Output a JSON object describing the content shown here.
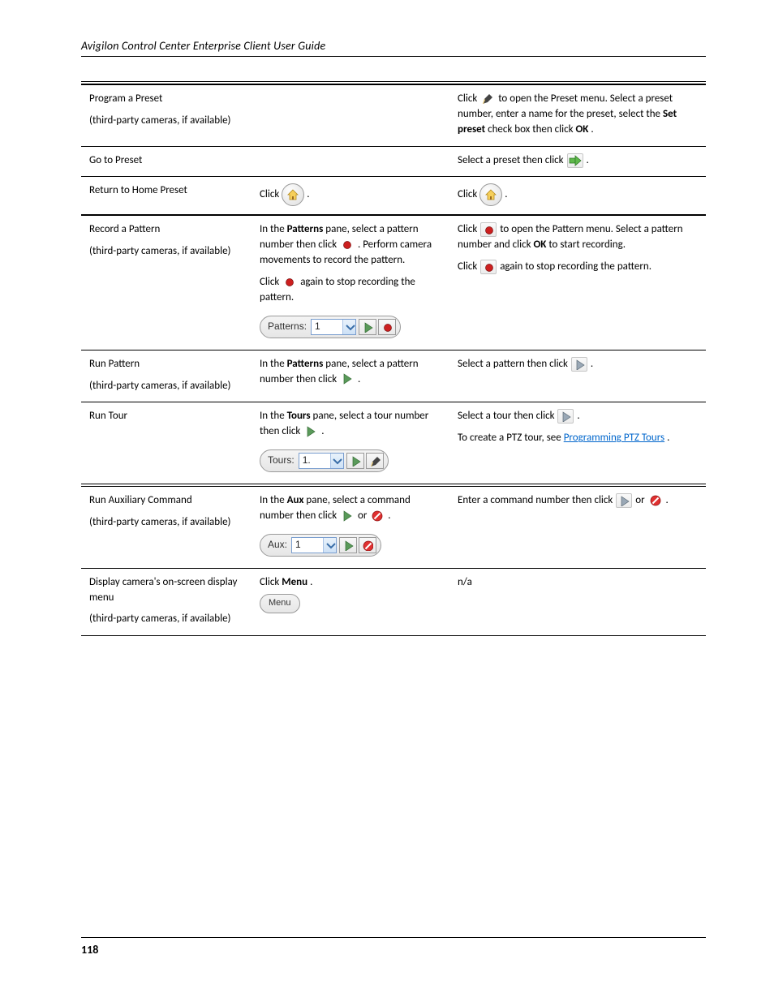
{
  "header": {
    "title": "Avigilon Control Center Enterprise Client User Guide"
  },
  "footer": {
    "page": "118"
  },
  "rows": [
    {
      "c1_a": "Program a Preset",
      "c1_b": "(third-party cameras, if available)",
      "c3_a": "Click ",
      "c3_b": " to open the Preset menu. Select a preset number, enter a name for the preset, select the ",
      "c3_c": "Set preset",
      "c3_d": " check box then click ",
      "c3_e": "OK",
      "c3_f": "."
    },
    {
      "c1_a": "Go to Preset",
      "c3_a": "Select a preset then click ",
      "c3_b": "."
    },
    {
      "c1_a": "Return to Home Preset",
      "c2_a": "Click ",
      "c2_b": ".",
      "c3_a": "Click ",
      "c3_b": "."
    },
    {
      "c1_a": "Record a Pattern",
      "c1_b": "(third-party cameras, if available)",
      "c2_a": "In the ",
      "c2_b": "Patterns",
      "c2_c": " pane, select a pattern number then click ",
      "c2_d": ". Perform camera movements to record the pattern.",
      "c2_e": "Click ",
      "c2_f": " again to stop recording the pattern.",
      "c3_a": "Click ",
      "c3_b": " to open the Pattern menu. Select a pattern number and click ",
      "c3_c": "OK",
      "c3_d": " to start recording.",
      "c3_e": "Click ",
      "c3_f": " again to stop recording the pattern.",
      "patterns_label": "Patterns:",
      "patterns_value": "1"
    },
    {
      "c1_a": "Run Pattern",
      "c1_b": "(third-party cameras, if available)",
      "c2_a": "In the ",
      "c2_b": "Patterns",
      "c2_c": " pane, select a pattern number then click ",
      "c2_d": ".",
      "c3_a": "Select a pattern then click ",
      "c3_b": "."
    },
    {
      "c1_a": "Run Tour",
      "c2_a": "In the ",
      "c2_b": "Tours",
      "c2_c": " pane, select a tour number then click ",
      "c2_d": ".",
      "c3_a": "Select a tour then click ",
      "c3_b": ".",
      "c3_c": "To create a PTZ tour, see ",
      "c3_link": "Programming PTZ Tours",
      "c3_d": ".",
      "tours_label": "Tours:",
      "tours_value": "1."
    },
    {
      "c1_a": "Run Auxiliary Command",
      "c1_b": "(third-party cameras, if available)",
      "c2_a": "In the ",
      "c2_b": "Aux",
      "c2_c": " pane, select a command number then click ",
      "c2_d": " or ",
      "c2_e": ".",
      "c3_a": "Enter a command number then click ",
      "c3_b": " or ",
      "c3_c": ".",
      "aux_label": "Aux:",
      "aux_value": "1"
    },
    {
      "c1_a": "Display camera's on-screen display menu",
      "c1_b": "(third-party cameras, if available)",
      "c2_a": "Click ",
      "c2_b": "Menu",
      "c2_c": ".",
      "c3_a": "n/a",
      "menu_label": "Menu"
    }
  ]
}
